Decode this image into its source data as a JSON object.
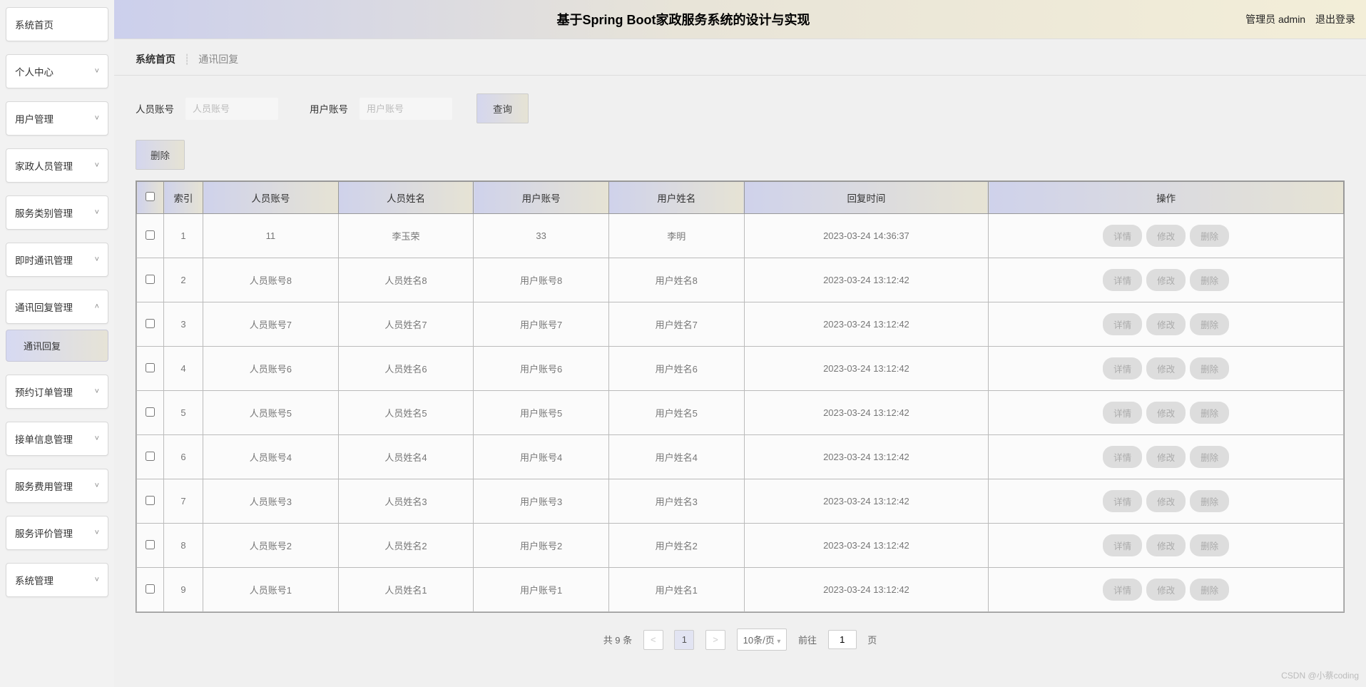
{
  "header": {
    "title": "基于Spring Boot家政服务系统的设计与实现",
    "role_label": "管理员 admin",
    "logout": "退出登录"
  },
  "sidebar": {
    "items": [
      {
        "label": "系统首页",
        "arrow": false
      },
      {
        "label": "个人中心",
        "arrow": true,
        "expanded": false
      },
      {
        "label": "用户管理",
        "arrow": true,
        "expanded": false
      },
      {
        "label": "家政人员管理",
        "arrow": true,
        "expanded": false
      },
      {
        "label": "服务类别管理",
        "arrow": true,
        "expanded": false
      },
      {
        "label": "即时通讯管理",
        "arrow": true,
        "expanded": false
      },
      {
        "label": "通讯回复管理",
        "arrow": true,
        "expanded": true
      },
      {
        "label": "预约订单管理",
        "arrow": true,
        "expanded": false
      },
      {
        "label": "接单信息管理",
        "arrow": true,
        "expanded": false
      },
      {
        "label": "服务费用管理",
        "arrow": true,
        "expanded": false
      },
      {
        "label": "服务评价管理",
        "arrow": true,
        "expanded": false
      },
      {
        "label": "系统管理",
        "arrow": true,
        "expanded": false
      }
    ],
    "submenu_label": "通讯回复"
  },
  "breadcrumb": {
    "home": "系统首页",
    "current": "通讯回复"
  },
  "filters": {
    "staff_label": "人员账号",
    "staff_placeholder": "人员账号",
    "user_label": "用户账号",
    "user_placeholder": "用户账号",
    "query_btn": "查询",
    "delete_btn": "删除"
  },
  "table": {
    "headers": [
      "索引",
      "人员账号",
      "人员姓名",
      "用户账号",
      "用户姓名",
      "回复时间",
      "操作"
    ],
    "row_actions": {
      "detail": "详情",
      "edit": "修改",
      "delete": "删除"
    },
    "rows": [
      {
        "idx": "1",
        "staff_acc": "11",
        "staff_name": "李玉荣",
        "user_acc": "33",
        "user_name": "李明",
        "time": "2023-03-24 14:36:37"
      },
      {
        "idx": "2",
        "staff_acc": "人员账号8",
        "staff_name": "人员姓名8",
        "user_acc": "用户账号8",
        "user_name": "用户姓名8",
        "time": "2023-03-24 13:12:42"
      },
      {
        "idx": "3",
        "staff_acc": "人员账号7",
        "staff_name": "人员姓名7",
        "user_acc": "用户账号7",
        "user_name": "用户姓名7",
        "time": "2023-03-24 13:12:42"
      },
      {
        "idx": "4",
        "staff_acc": "人员账号6",
        "staff_name": "人员姓名6",
        "user_acc": "用户账号6",
        "user_name": "用户姓名6",
        "time": "2023-03-24 13:12:42"
      },
      {
        "idx": "5",
        "staff_acc": "人员账号5",
        "staff_name": "人员姓名5",
        "user_acc": "用户账号5",
        "user_name": "用户姓名5",
        "time": "2023-03-24 13:12:42"
      },
      {
        "idx": "6",
        "staff_acc": "人员账号4",
        "staff_name": "人员姓名4",
        "user_acc": "用户账号4",
        "user_name": "用户姓名4",
        "time": "2023-03-24 13:12:42"
      },
      {
        "idx": "7",
        "staff_acc": "人员账号3",
        "staff_name": "人员姓名3",
        "user_acc": "用户账号3",
        "user_name": "用户姓名3",
        "time": "2023-03-24 13:12:42"
      },
      {
        "idx": "8",
        "staff_acc": "人员账号2",
        "staff_name": "人员姓名2",
        "user_acc": "用户账号2",
        "user_name": "用户姓名2",
        "time": "2023-03-24 13:12:42"
      },
      {
        "idx": "9",
        "staff_acc": "人员账号1",
        "staff_name": "人员姓名1",
        "user_acc": "用户账号1",
        "user_name": "用户姓名1",
        "time": "2023-03-24 13:12:42"
      }
    ]
  },
  "pagination": {
    "total_text": "共 9 条",
    "prev": "<",
    "page": "1",
    "next": ">",
    "size_sel": "10条/页",
    "goto_prefix": "前往",
    "goto_value": "1",
    "goto_suffix": "页"
  },
  "watermark": "CSDN @小蔡coding"
}
